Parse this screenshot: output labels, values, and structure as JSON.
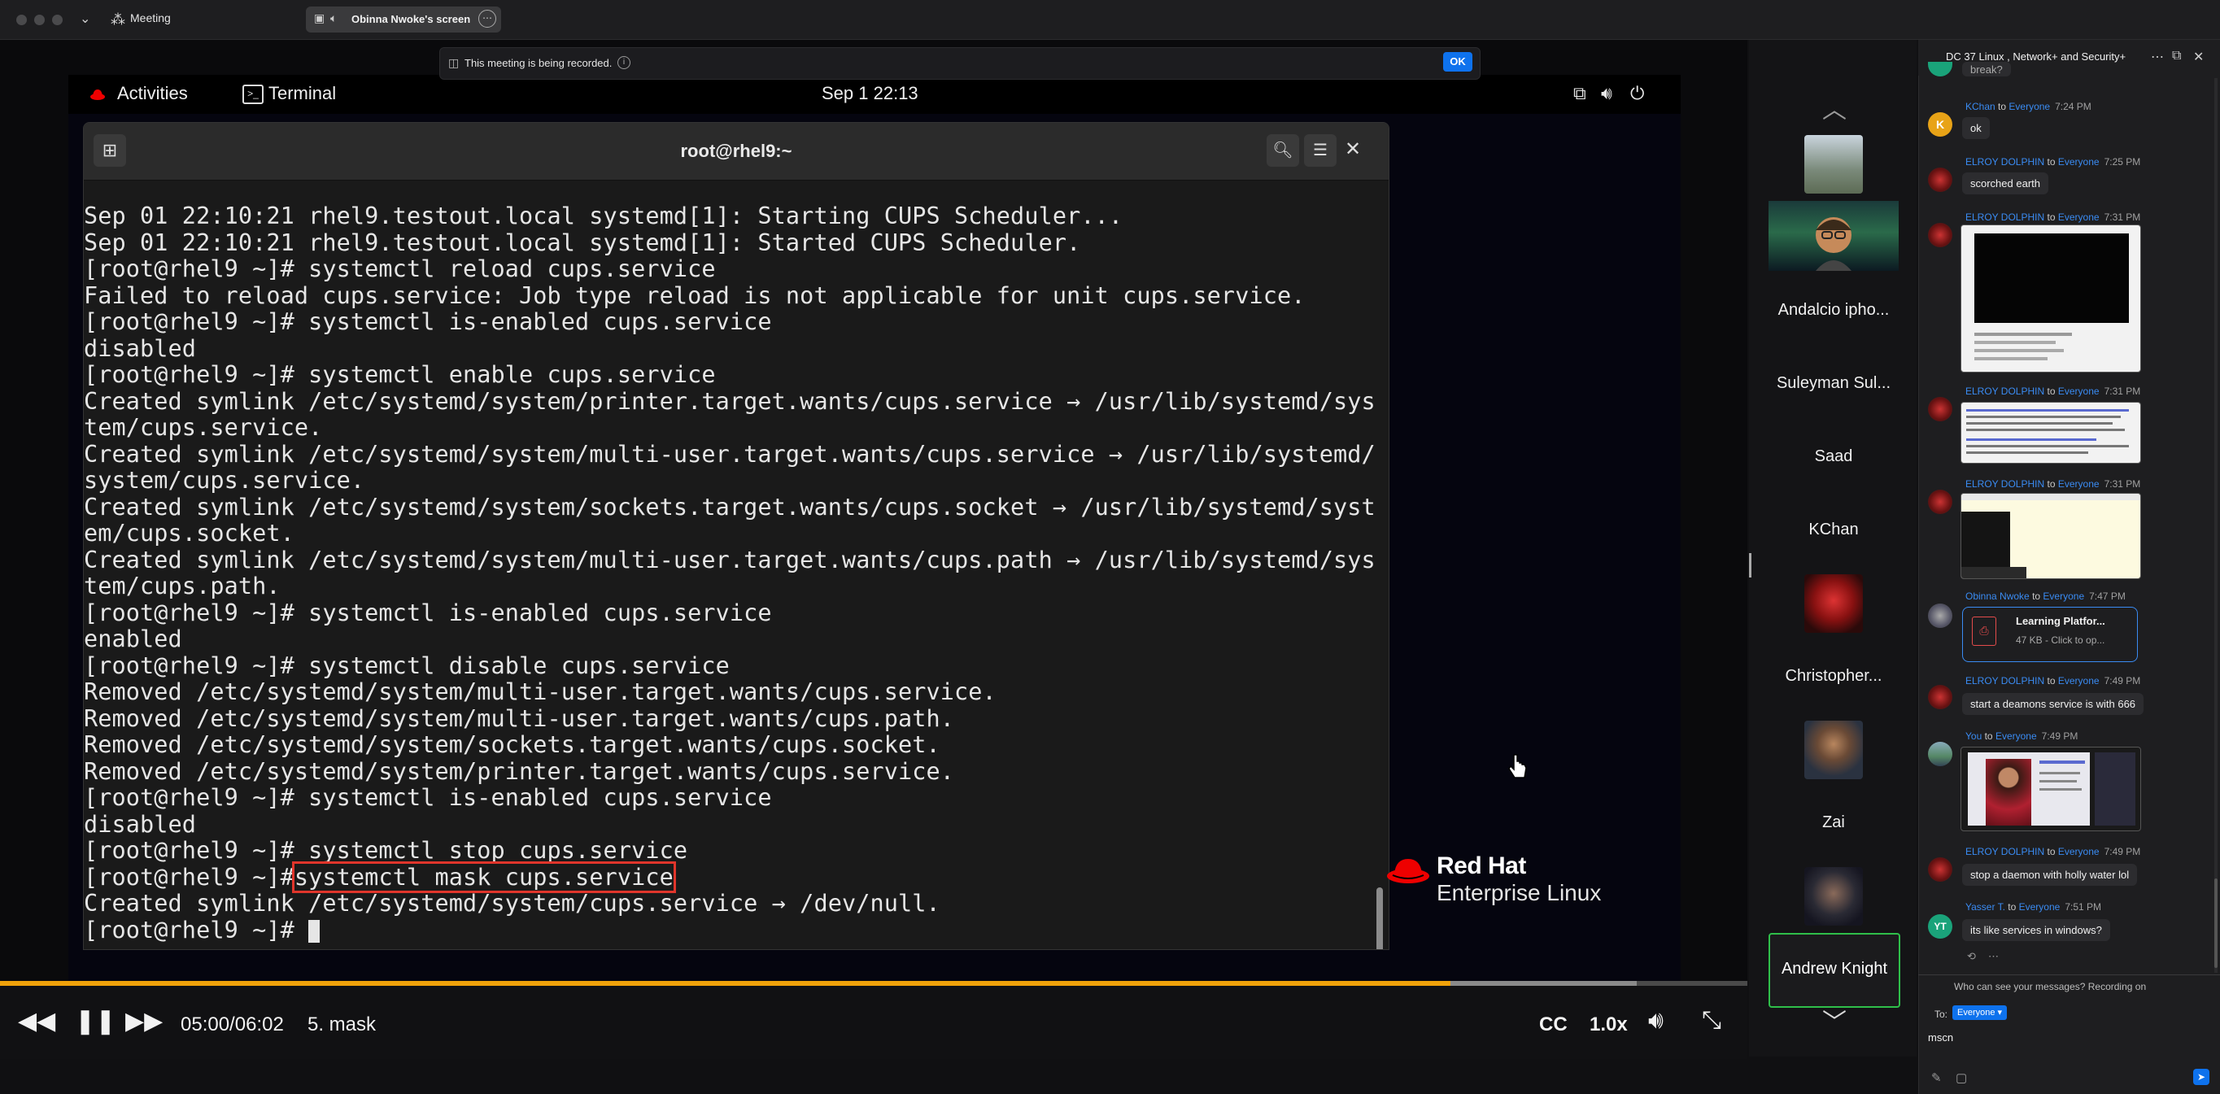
{
  "topbar": {
    "app_title": "Meeting",
    "share_tab": "Obinna Nwoke's screen"
  },
  "recording_banner": {
    "text": "This meeting is being recorded.",
    "ok_label": "OK"
  },
  "desktop": {
    "activities": "Activities",
    "app": "Terminal",
    "clock": "Sep 1  22:13",
    "terminal_title": "root@rhel9:~",
    "terminal_lines": [
      "Sep 01 22:10:21 rhel9.testout.local systemd[1]: Starting CUPS Scheduler...",
      "Sep 01 22:10:21 rhel9.testout.local systemd[1]: Started CUPS Scheduler.",
      "[root@rhel9 ~]# systemctl reload cups.service",
      "Failed to reload cups.service: Job type reload is not applicable for unit cups.service.",
      "[root@rhel9 ~]# systemctl is-enabled cups.service",
      "disabled",
      "[root@rhel9 ~]# systemctl enable cups.service",
      "Created symlink /etc/systemd/system/printer.target.wants/cups.service → /usr/lib/systemd/sys",
      "tem/cups.service.",
      "Created symlink /etc/systemd/system/multi-user.target.wants/cups.service → /usr/lib/systemd/",
      "system/cups.service.",
      "Created symlink /etc/systemd/system/sockets.target.wants/cups.socket → /usr/lib/systemd/syst",
      "em/cups.socket.",
      "Created symlink /etc/systemd/system/multi-user.target.wants/cups.path → /usr/lib/systemd/sys",
      "tem/cups.path.",
      "[root@rhel9 ~]# systemctl is-enabled cups.service",
      "enabled",
      "[root@rhel9 ~]# systemctl disable cups.service",
      "Removed /etc/systemd/system/multi-user.target.wants/cups.service.",
      "Removed /etc/systemd/system/multi-user.target.wants/cups.path.",
      "Removed /etc/systemd/system/sockets.target.wants/cups.socket.",
      "Removed /etc/systemd/system/printer.target.wants/cups.service.",
      "[root@rhel9 ~]# systemctl is-enabled cups.service",
      "disabled",
      "[root@rhel9 ~]# systemctl stop cups.service"
    ],
    "mask_prompt": "[root@rhel9 ~]#",
    "mask_command": "systemctl mask cups.service",
    "after_mask": "Created symlink /etc/systemd/system/cups.service → /dev/null.",
    "final_prompt": "[root@rhel9 ~]# ",
    "logo_name": "Red Hat",
    "logo_sub": "Enterprise Linux"
  },
  "player": {
    "time": "05:00/06:02",
    "chapter": "5. mask",
    "cc": "CC",
    "speed": "1.0x",
    "progress_fraction": 0.83,
    "accent": "#f0a20a"
  },
  "participants": [
    {
      "name": ""
    },
    {
      "name": ""
    },
    {
      "name": "Andalcio ipho..."
    },
    {
      "name": "Suleyman Sul..."
    },
    {
      "name": "Saad"
    },
    {
      "name": "KChan"
    },
    {
      "name": ""
    },
    {
      "name": "Christopher..."
    },
    {
      "name": ""
    },
    {
      "name": "Zai"
    },
    {
      "name": ""
    },
    {
      "name": "Andrew Knight"
    }
  ],
  "chat": {
    "title": "DC 37 Linux , Network+ and Security+",
    "top_cut": "break?",
    "messages": [
      {
        "from": "KChan",
        "to": "Everyone",
        "time": "7:24 PM",
        "text": "ok",
        "initial": "K"
      },
      {
        "from": "ELROY DOLPHIN",
        "to": "Everyone",
        "time": "7:25 PM",
        "text": "scorched earth"
      },
      {
        "from": "ELROY DOLPHIN",
        "to": "Everyone",
        "time": "7:31 PM",
        "text": ""
      },
      {
        "from": "ELROY DOLPHIN",
        "to": "Everyone",
        "time": "7:31 PM",
        "text": ""
      },
      {
        "from": "ELROY DOLPHIN",
        "to": "Everyone",
        "time": "7:31 PM",
        "text": ""
      },
      {
        "from": "Obinna Nwoke",
        "to": "Everyone",
        "time": "7:47 PM",
        "text": ""
      },
      {
        "from": "ELROY DOLPHIN",
        "to": "Everyone",
        "time": "7:49 PM",
        "text": "start a deamons service is with 666"
      },
      {
        "from": "You",
        "to": "Everyone",
        "time": "7:49 PM",
        "text": ""
      },
      {
        "from": "ELROY DOLPHIN",
        "to": "Everyone",
        "time": "7:49 PM",
        "text": "stop a daemon with holly water lol"
      },
      {
        "from": "Yasser T.",
        "to": "Everyone",
        "time": "7:51 PM",
        "text": "its like services in windows?",
        "initial": "YT"
      }
    ],
    "file": {
      "name": "Learning Platfor...",
      "meta": "47 KB - Click to op..."
    },
    "to_word": "to",
    "who_can_see": "Who can see your messages? Recording on",
    "to_label": "To:",
    "to_target": "Everyone",
    "draft": "mscn"
  },
  "colors": {
    "link_blue": "#3a8bf2",
    "zoom_blue": "#0e72ed",
    "active_speaker": "#2fbf4a",
    "highlight_red": "#e0352b"
  },
  "icons": [
    "chevron-down-icon",
    "meeting-icon",
    "screen-share-icon",
    "volume-icon",
    "more-icon",
    "info-icon",
    "search-icon",
    "menu-icon",
    "close-icon",
    "network-icon",
    "power-icon",
    "rewind-icon",
    "pause-icon",
    "forward-icon",
    "fullscreen-icon",
    "popout-icon",
    "send-icon"
  ]
}
